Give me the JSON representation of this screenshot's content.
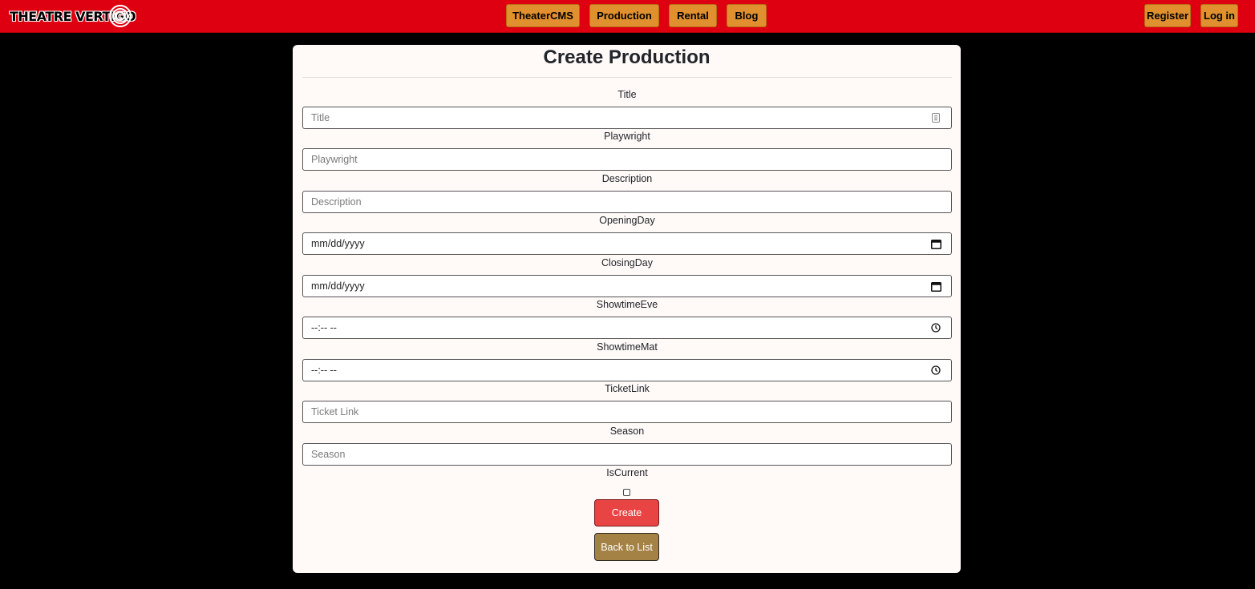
{
  "brand": {
    "name": "THEATRE VERTIGO"
  },
  "nav": {
    "center_items": [
      {
        "label": "TheaterCMS"
      },
      {
        "label": "Production"
      },
      {
        "label": "Rental"
      },
      {
        "label": "Blog"
      }
    ],
    "right_items": [
      {
        "label": "Register"
      },
      {
        "label": "Log in"
      }
    ]
  },
  "form": {
    "title": "Create Production",
    "fields": {
      "title": {
        "label": "Title",
        "placeholder": "Title"
      },
      "playwright": {
        "label": "Playwright",
        "placeholder": "Playwright"
      },
      "description": {
        "label": "Description",
        "placeholder": "Description"
      },
      "opening_day": {
        "label": "OpeningDay",
        "value": "mm/dd/yyyy",
        "icon": "calendar-icon"
      },
      "closing_day": {
        "label": "ClosingDay",
        "value": "mm/dd/yyyy",
        "icon": "calendar-icon"
      },
      "showtime_eve": {
        "label": "ShowtimeEve",
        "value": "--:-- --",
        "icon": "clock-icon"
      },
      "showtime_mat": {
        "label": "ShowtimeMat",
        "value": "--:-- --",
        "icon": "clock-icon"
      },
      "ticket_link": {
        "label": "TicketLink",
        "placeholder": "Ticket Link"
      },
      "season": {
        "label": "Season",
        "placeholder": "Season"
      },
      "is_current": {
        "label": "IsCurrent",
        "checked": false
      }
    },
    "create_label": "Create",
    "back_label": "Back to List"
  },
  "colors": {
    "navbar": "#de0010",
    "nav_button": "#e0902e",
    "page_bg": "#000000",
    "card_bg": "#fff9f8",
    "create_button": "#e84444",
    "back_button": "#a48245"
  }
}
